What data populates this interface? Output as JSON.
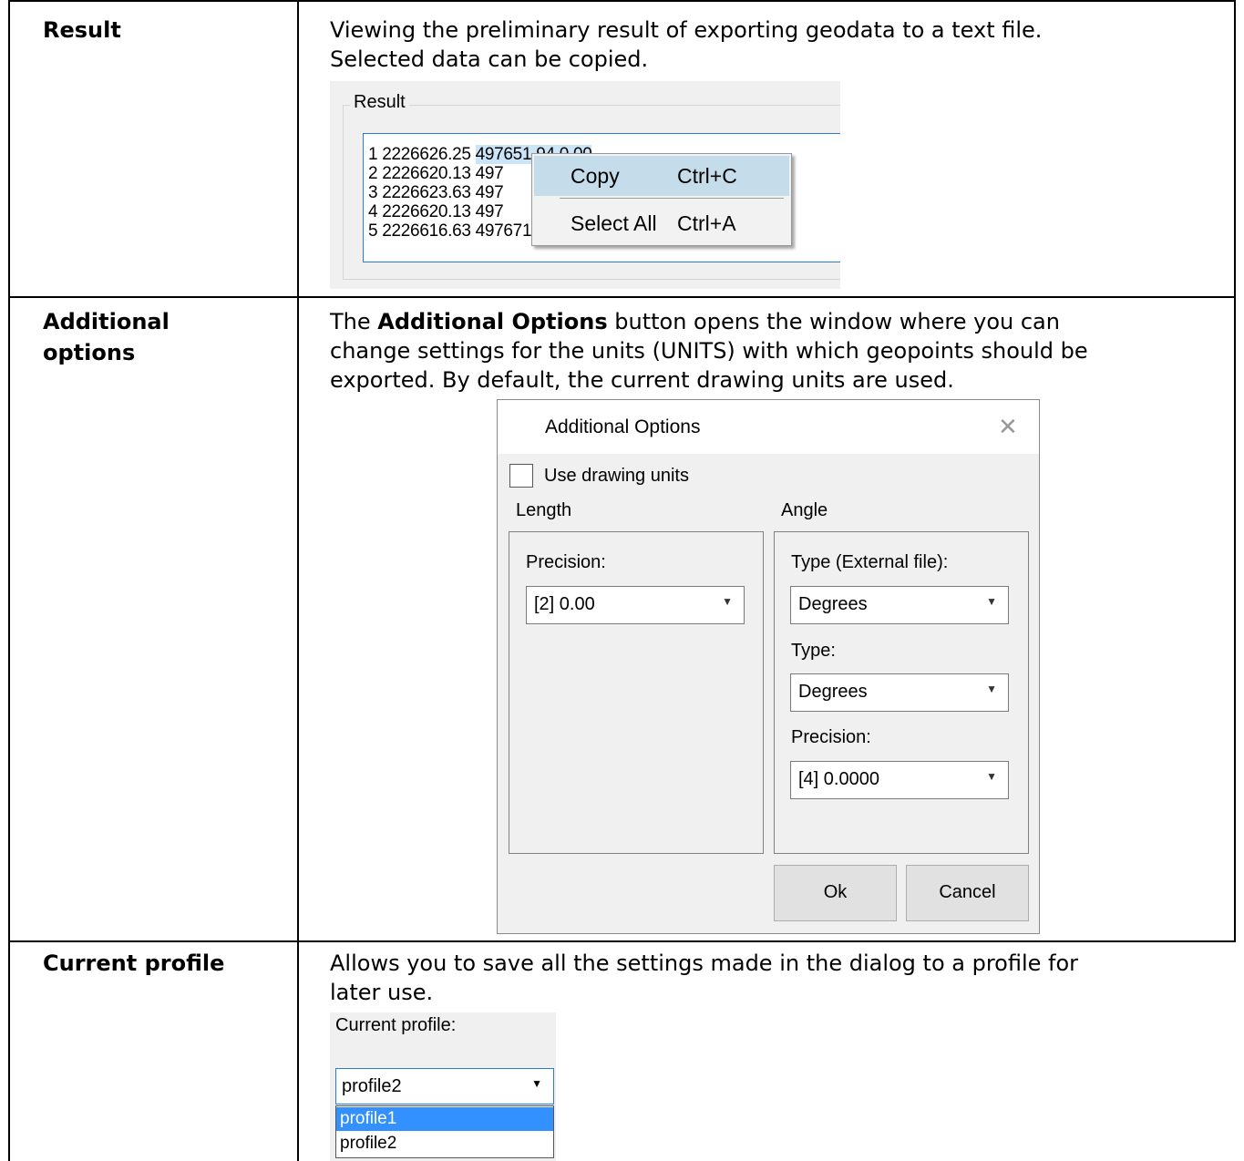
{
  "rows": [
    {
      "label": "Result",
      "description": [
        "Viewing the preliminary result of exporting geodata to a text file.",
        "Selected data can be copied."
      ]
    },
    {
      "label_lines": [
        "Additional",
        "options"
      ],
      "description_parts": {
        "pre": "The ",
        "bold": "Additional Options",
        "post": " button opens the window where you can"
      },
      "description_rest": [
        "change settings for the units (UNITS) with which geopoints should be",
        "exported. By default, the current drawing units are used."
      ]
    },
    {
      "label": "Current profile",
      "description": [
        "Allows you to save all the settings made in the dialog to a profile for",
        "later use."
      ]
    }
  ],
  "result_panel": {
    "group_title": "Result",
    "lines": [
      {
        "before": "1 2226626.25 ",
        "selected": "497651.94 0.00"
      },
      {
        "before": "2 2226620.13 497",
        "selected": ""
      },
      {
        "before": "3 2226623.63 497",
        "selected": ""
      },
      {
        "before": "4 2226620.13 497",
        "selected": ""
      },
      {
        "before": "5 2226616.63 497671.00 0.00",
        "selected": ""
      }
    ],
    "context_menu": [
      {
        "label": "Copy",
        "shortcut": "Ctrl+C"
      },
      {
        "label": "Select All",
        "shortcut": "Ctrl+A"
      }
    ]
  },
  "additional_options_dialog": {
    "title": "Additional Options",
    "use_drawing_units_label": "Use drawing units",
    "length_group": "Length",
    "angle_group": "Angle",
    "length_precision_label": "Precision:",
    "length_precision_value": "[2] 0.00",
    "angle_type_external_label": "Type (External file):",
    "angle_type_external_value": "Degrees",
    "angle_type_label": "Type:",
    "angle_type_value": "Degrees",
    "angle_precision_label": "Precision:",
    "angle_precision_value": "[4] 0.0000",
    "ok_label": "Ok",
    "cancel_label": "Cancel",
    "close_icon": "close-icon"
  },
  "profile_panel": {
    "label": "Current profile:",
    "selected_value": "profile2",
    "options": [
      "profile1",
      "profile2"
    ],
    "highlighted_option": "profile1"
  }
}
